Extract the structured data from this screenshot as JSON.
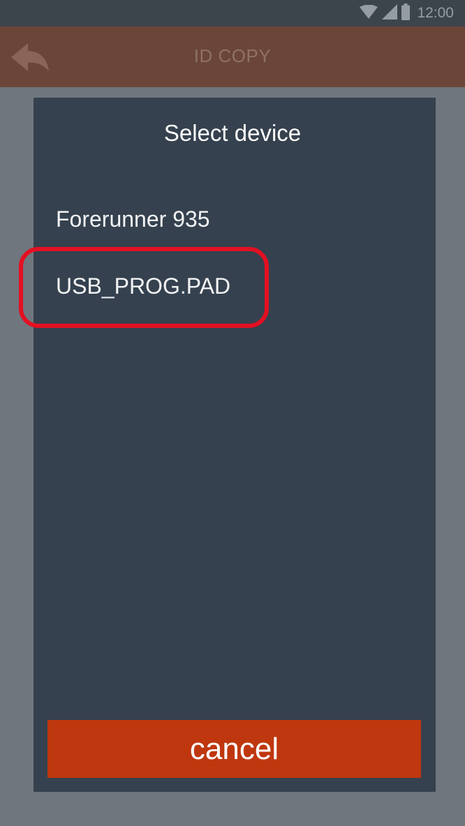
{
  "status_bar": {
    "time": "12:00",
    "icons": [
      "wifi-icon",
      "cellular-signal-icon",
      "battery-icon"
    ]
  },
  "app_bar": {
    "title": "ID COPY",
    "back_icon": "back-arrow-icon",
    "color": "#6b4638"
  },
  "dialog": {
    "title": "Select device",
    "devices": [
      {
        "label": "Forerunner 935"
      },
      {
        "label": "USB_PROG.PAD"
      }
    ],
    "cancel_label": "cancel",
    "cancel_color": "#bf370e",
    "highlighted_device": "USB_PROG.PAD",
    "highlight_color": "#e31022"
  }
}
